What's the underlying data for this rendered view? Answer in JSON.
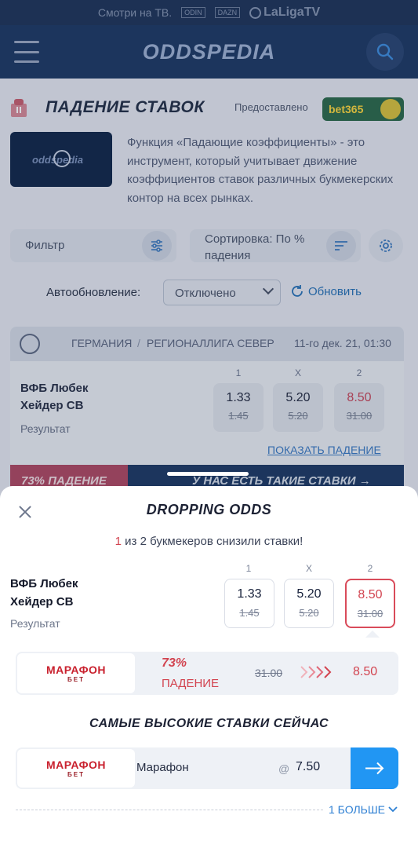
{
  "tv_strip": {
    "label": "Смотри на ТВ.",
    "channel1": "ODIN",
    "channel2": "DAZN",
    "channel3": "LaLigaTV"
  },
  "header": {
    "brand": "ODDSPEDIA"
  },
  "page": {
    "title": "ПАДЕНИЕ СТАВОК",
    "provided_by": "Предоставлено",
    "sponsor": "bet365",
    "thumb_brand": "oddspedia",
    "intro": "Функция «Падающие коэффициенты» - это инструмент, который учитывает движение коэффициентов ставок различных букмекерских контор на всех рынках."
  },
  "filters": {
    "filter_label": "Фильтр",
    "sort_label": "Сортировка: По % падения",
    "auto_refresh_label": "Автообновление:",
    "auto_refresh_value": "Отключено",
    "refresh_label": "Обновить"
  },
  "match_card": {
    "country": "ГЕРМАНИЯ",
    "league_separator": "/",
    "league": "РЕГИОНАЛЛИГА СЕВЕР",
    "datetime": "11-го дек. 21, 01:30",
    "home": "ВФБ Любек",
    "away": "Хейдер СВ",
    "market": "Результат",
    "columns": [
      "1",
      "X",
      "2"
    ],
    "odds": [
      {
        "current": "1.33",
        "previous": "1.45"
      },
      {
        "current": "5.20",
        "previous": "5.20"
      },
      {
        "current": "8.50",
        "previous": "31.00"
      }
    ],
    "show_drop_link": "ПОКАЗАТЬ ПАДЕНИЕ",
    "promo_left": "73% ПАДЕНИЕ",
    "promo_right": "У НАС ЕСТЬ ТАКИЕ СТАВКИ →"
  },
  "sheet": {
    "title": "DROPPING ODDS",
    "summary_count": "1",
    "summary_text": " из 2 букмекеров снизили ставки!",
    "home": "ВФБ Любек",
    "away": "Хейдер СВ",
    "market": "Результат",
    "columns": [
      "1",
      "X",
      "2"
    ],
    "odds": [
      {
        "current": "1.33",
        "previous": "1.45"
      },
      {
        "current": "5.20",
        "previous": "5.20"
      },
      {
        "current": "8.50",
        "previous": "31.00"
      }
    ],
    "bookmaker": {
      "logo_main": "МАРАФОН",
      "logo_sub": "БЕТ",
      "drop_percent": "73%",
      "drop_label": "ПАДЕНИЕ",
      "old_odd": "31.00",
      "new_odd": "8.50"
    },
    "best_title": "САМЫЕ ВЫСОКИЕ СТАВКИ СЕЙЧАС",
    "best": {
      "logo_main": "МАРАФОН",
      "logo_sub": "БЕТ",
      "name": "Марафон",
      "at": "@",
      "odd": "7.50"
    },
    "more_label": "1 БОЛЬШЕ"
  },
  "colors": {
    "header_bg": "#1e3a64",
    "drop_red": "#d2434f",
    "accent_blue": "#2196f3"
  }
}
